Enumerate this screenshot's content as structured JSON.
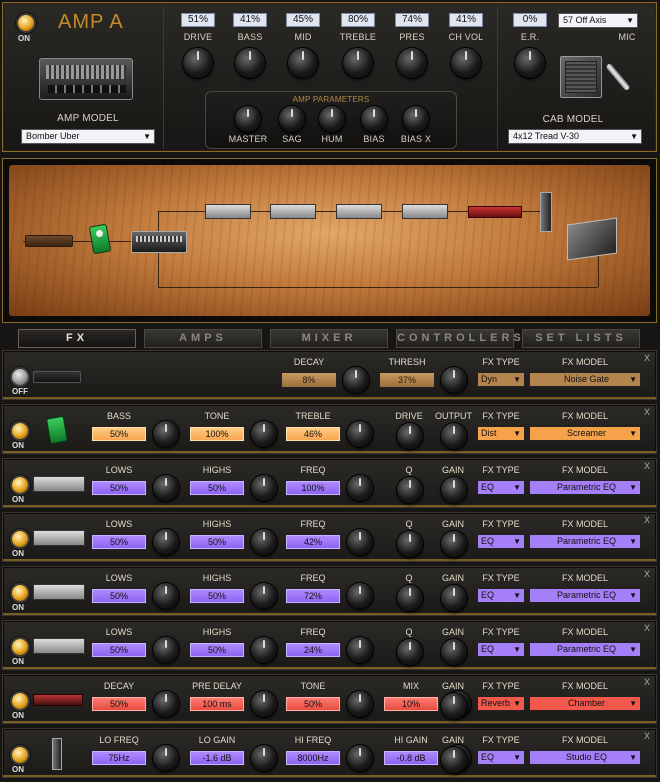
{
  "amp": {
    "power_label": "ON",
    "title": "AMP A",
    "knobs": [
      {
        "label": "DRIVE",
        "value": "51%"
      },
      {
        "label": "BASS",
        "value": "41%"
      },
      {
        "label": "MID",
        "value": "45%"
      },
      {
        "label": "TREBLE",
        "value": "80%"
      },
      {
        "label": "PRES",
        "value": "74%"
      },
      {
        "label": "CH VOL",
        "value": "41%"
      }
    ],
    "params_title": "AMP PARAMETERS",
    "params": [
      "MASTER",
      "SAG",
      "HUM",
      "BIAS",
      "BIAS X"
    ],
    "model_label": "AMP MODEL",
    "model_value": "Bomber Uber",
    "er_label": "E.R.",
    "er_value": "0%",
    "mic_label": "MIC",
    "mic_value": "57 Off Axis",
    "cab_label": "CAB MODEL",
    "cab_value": "4x12 Tread V-30"
  },
  "tabs": [
    "FX",
    "AMPS",
    "MIXER",
    "CONTROLLERS",
    "SET LISTS"
  ],
  "fx_type_label": "FX TYPE",
  "fx_model_label": "FX MODEL",
  "close_glyph": "X",
  "rows": [
    {
      "power": "OFF",
      "controls": [
        {
          "label": "DECAY",
          "value": "8%"
        },
        {
          "label": "THRESH",
          "value": "37%"
        }
      ],
      "type": "Dyn",
      "model": "Noise Gate",
      "color": "tan"
    },
    {
      "power": "ON",
      "controls": [
        {
          "label": "BASS",
          "value": "50%"
        },
        {
          "label": "TONE",
          "value": "100%"
        },
        {
          "label": "TREBLE",
          "value": "46%"
        },
        {
          "label": "DRIVE",
          "value": ""
        },
        {
          "label": "OUTPUT",
          "value": ""
        }
      ],
      "type": "Dist",
      "model": "Screamer",
      "color": "orange"
    },
    {
      "power": "ON",
      "controls": [
        {
          "label": "LOWS",
          "value": "50%"
        },
        {
          "label": "HIGHS",
          "value": "50%"
        },
        {
          "label": "FREQ",
          "value": "100%"
        },
        {
          "label": "Q",
          "value": ""
        },
        {
          "label": "GAIN",
          "value": ""
        }
      ],
      "type": "EQ",
      "model": "Parametric EQ",
      "color": "purple"
    },
    {
      "power": "ON",
      "controls": [
        {
          "label": "LOWS",
          "value": "50%"
        },
        {
          "label": "HIGHS",
          "value": "50%"
        },
        {
          "label": "FREQ",
          "value": "42%"
        },
        {
          "label": "Q",
          "value": ""
        },
        {
          "label": "GAIN",
          "value": ""
        }
      ],
      "type": "EQ",
      "model": "Parametric EQ",
      "color": "purple"
    },
    {
      "power": "ON",
      "controls": [
        {
          "label": "LOWS",
          "value": "50%"
        },
        {
          "label": "HIGHS",
          "value": "50%"
        },
        {
          "label": "FREQ",
          "value": "72%"
        },
        {
          "label": "Q",
          "value": ""
        },
        {
          "label": "GAIN",
          "value": ""
        }
      ],
      "type": "EQ",
      "model": "Parametric EQ",
      "color": "purple"
    },
    {
      "power": "ON",
      "controls": [
        {
          "label": "LOWS",
          "value": "50%"
        },
        {
          "label": "HIGHS",
          "value": "50%"
        },
        {
          "label": "FREQ",
          "value": "24%"
        },
        {
          "label": "Q",
          "value": ""
        },
        {
          "label": "GAIN",
          "value": ""
        }
      ],
      "type": "EQ",
      "model": "Parametric EQ",
      "color": "purple"
    },
    {
      "power": "ON",
      "controls": [
        {
          "label": "DECAY",
          "value": "50%"
        },
        {
          "label": "PRE DELAY",
          "value": "100 ms"
        },
        {
          "label": "TONE",
          "value": "50%"
        },
        {
          "label": "MIX",
          "value": "10%"
        },
        {
          "label": "GAIN",
          "value": ""
        }
      ],
      "type": "Reverb",
      "model": "Chamber",
      "color": "red"
    },
    {
      "power": "ON",
      "controls": [
        {
          "label": "LO FREQ",
          "value": "75Hz"
        },
        {
          "label": "LO GAIN",
          "value": "-1.6 dB"
        },
        {
          "label": "HI FREQ",
          "value": "8000Hz"
        },
        {
          "label": "HI GAIN",
          "value": "-0.8 dB"
        },
        {
          "label": "GAIN",
          "value": ""
        }
      ],
      "type": "EQ",
      "model": "Studio EQ",
      "color": "purple"
    }
  ]
}
